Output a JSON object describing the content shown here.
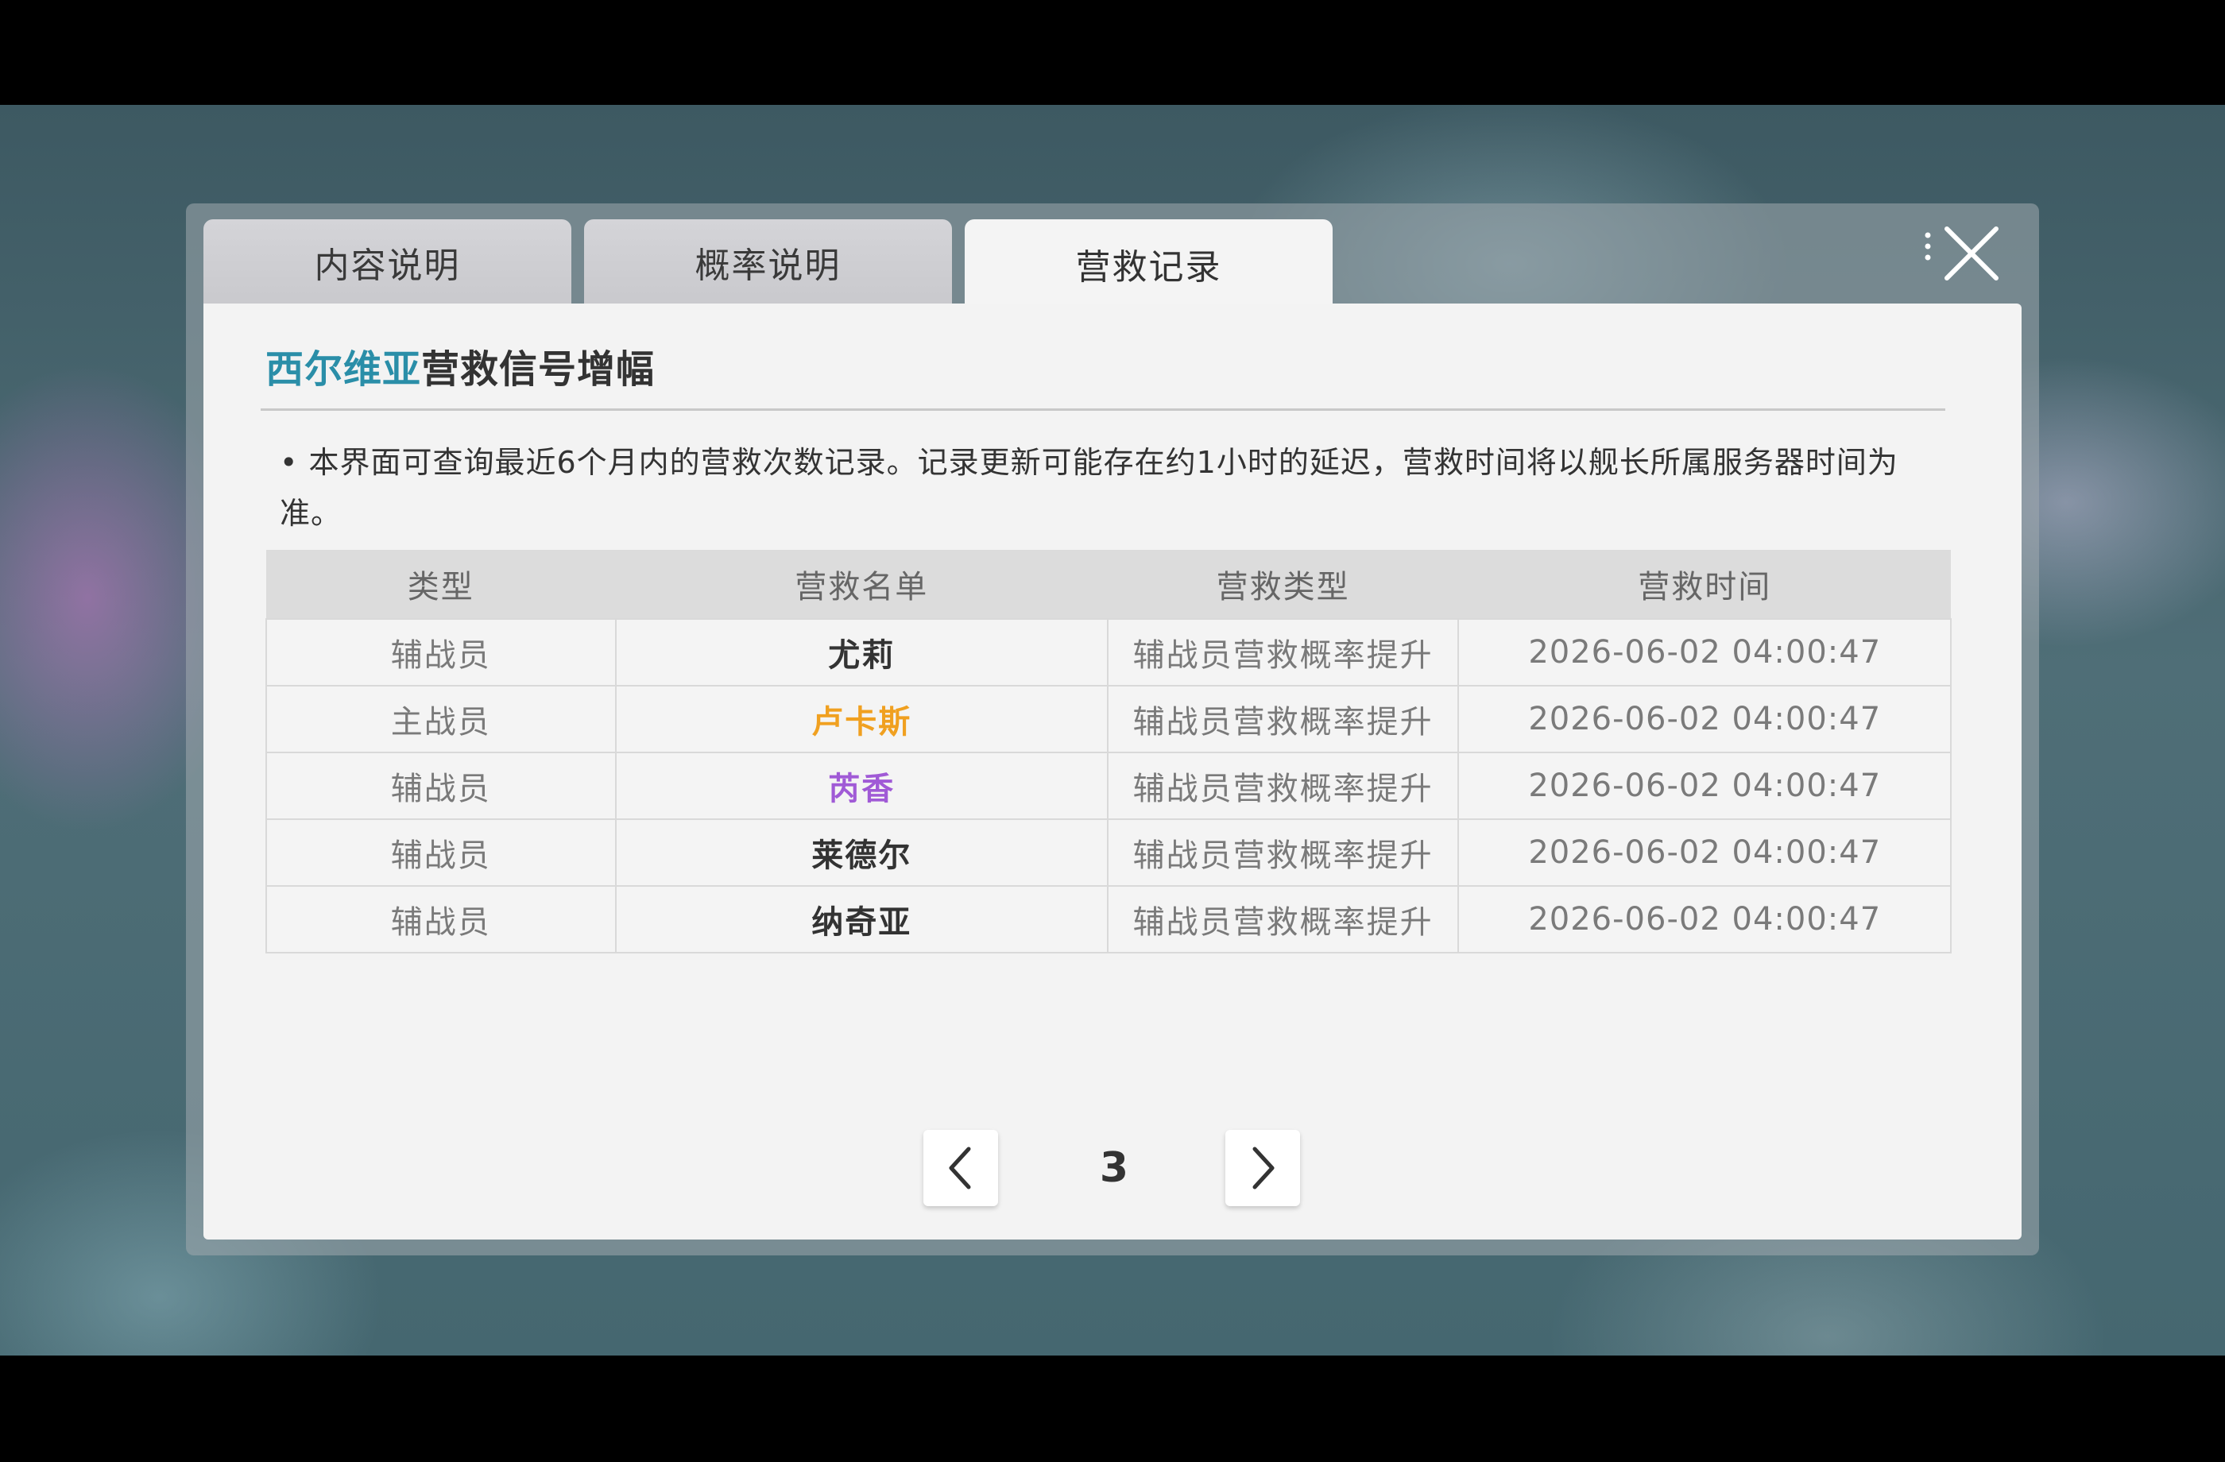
{
  "tabs": [
    {
      "label": "内容说明",
      "active": false
    },
    {
      "label": "概率说明",
      "active": false
    },
    {
      "label": "营救记录",
      "active": true
    }
  ],
  "title": {
    "highlight": "西尔维亚",
    "rest": "营救信号增幅",
    "highlight_color": "#2a8ea8"
  },
  "notice": "• 本界面可查询最近6个月内的营救次数记录。记录更新可能存在约1小时的延迟，营救时间将以舰长所属服务器时间为准。",
  "table": {
    "headers": [
      "类型",
      "营救名单",
      "营救类型",
      "营救时间"
    ],
    "rows": [
      {
        "type": "辅战员",
        "name": "尤莉",
        "name_color": "#333333",
        "rescue_type": "辅战员营救概率提升",
        "time": "2026-06-02 04:00:47"
      },
      {
        "type": "主战员",
        "name": "卢卡斯",
        "name_color": "#f0a020",
        "rescue_type": "辅战员营救概率提升",
        "time": "2026-06-02 04:00:47"
      },
      {
        "type": "辅战员",
        "name": "芮香",
        "name_color": "#a05ad6",
        "rescue_type": "辅战员营救概率提升",
        "time": "2026-06-02 04:00:47"
      },
      {
        "type": "辅战员",
        "name": "莱德尔",
        "name_color": "#333333",
        "rescue_type": "辅战员营救概率提升",
        "time": "2026-06-02 04:00:47"
      },
      {
        "type": "辅战员",
        "name": "纳奇亚",
        "name_color": "#333333",
        "rescue_type": "辅战员营救概率提升",
        "time": "2026-06-02 04:00:47"
      }
    ]
  },
  "pager": {
    "current_page": "3",
    "prev_icon": "chevron-left-icon",
    "next_icon": "chevron-right-icon"
  },
  "close_icon": "close-icon"
}
